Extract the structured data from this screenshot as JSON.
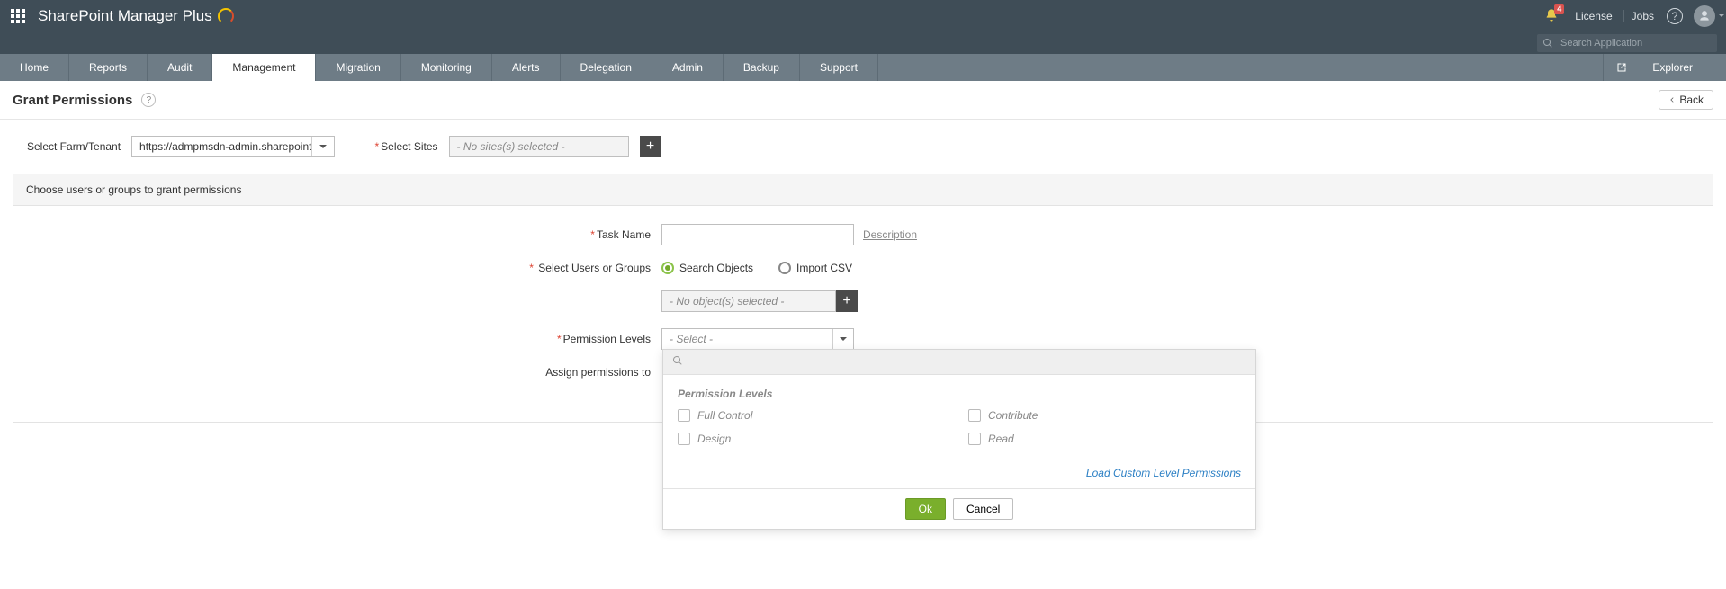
{
  "brand": "SharePoint Manager Plus",
  "notif_count": "4",
  "top_links": {
    "license": "License",
    "jobs": "Jobs"
  },
  "search_placeholder": "Search Application",
  "nav": {
    "home": "Home",
    "reports": "Reports",
    "audit": "Audit",
    "management": "Management",
    "migration": "Migration",
    "monitoring": "Monitoring",
    "alerts": "Alerts",
    "delegation": "Delegation",
    "admin": "Admin",
    "backup": "Backup",
    "support": "Support",
    "explorer": "Explorer"
  },
  "page_title": "Grant Permissions",
  "back_label": "Back",
  "farm": {
    "label": "Select Farm/Tenant",
    "value": "https://admpmsdn-admin.sharepoint",
    "sites_label": "Select Sites",
    "sites_placeholder": "- No sites(s) selected -"
  },
  "panel_head": "Choose users or groups to grant permissions",
  "form": {
    "task_name_label": "Task Name",
    "description_link": "Description",
    "select_users_label": "Select Users or Groups",
    "radio_search": "Search Objects",
    "radio_import": "Import CSV",
    "objects_placeholder": "- No object(s) selected -",
    "perm_levels_label": "Permission Levels",
    "perm_select_placeholder": "- Select -",
    "assign_to_label": "Assign permissions to"
  },
  "dropdown": {
    "title": "Permission Levels",
    "options": {
      "full_control": "Full Control",
      "contribute": "Contribute",
      "design": "Design",
      "read": "Read"
    },
    "load_custom": "Load Custom Level Permissions",
    "ok": "Ok",
    "cancel": "Cancel"
  }
}
